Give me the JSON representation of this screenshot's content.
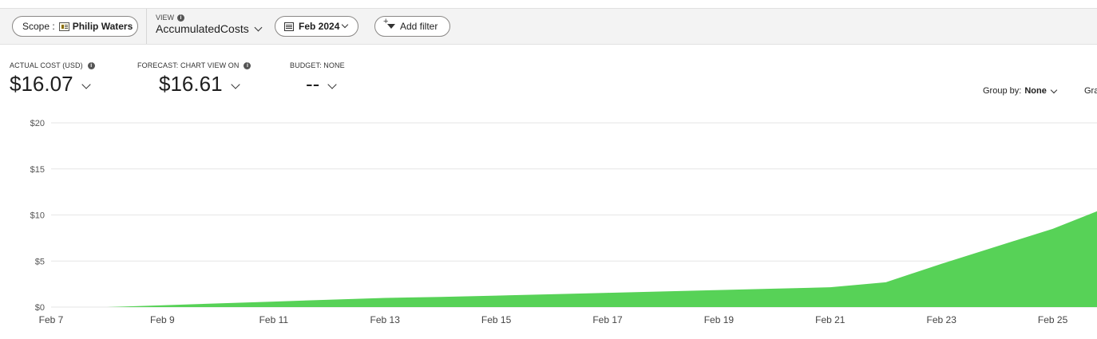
{
  "toolbar": {
    "scope_label": "Scope :",
    "scope_value": "Philip Waters",
    "view_label": "VIEW",
    "view_name": "AccumulatedCosts",
    "date_range": "Feb 2024",
    "add_filter": "Add filter"
  },
  "metrics": {
    "actual_label": "ACTUAL COST (USD)",
    "actual_value": "$16.07",
    "forecast_label": "FORECAST: CHART VIEW ON",
    "forecast_value": "$16.61",
    "budget_label": "BUDGET: NONE",
    "budget_value": "--"
  },
  "controls": {
    "group_by_label": "Group by:",
    "group_by_value": "None",
    "granularity_partial": "Gra"
  },
  "colors": {
    "accent": "#57d257",
    "toolbar": "#f3f3f3"
  },
  "chart_data": {
    "type": "area",
    "x": [
      "Feb 7",
      "Feb 8",
      "Feb 9",
      "Feb 10",
      "Feb 11",
      "Feb 12",
      "Feb 13",
      "Feb 14",
      "Feb 15",
      "Feb 16",
      "Feb 17",
      "Feb 18",
      "Feb 19",
      "Feb 20",
      "Feb 21",
      "Feb 22",
      "Feb 23",
      "Feb 24",
      "Feb 25",
      "Feb 26"
    ],
    "x_tick_labels": [
      "Feb 7",
      "Feb 9",
      "Feb 11",
      "Feb 13",
      "Feb 15",
      "Feb 17",
      "Feb 19",
      "Feb 21",
      "Feb 23",
      "Feb 25"
    ],
    "series": [
      {
        "values": [
          0,
          0,
          0.2,
          0.4,
          0.6,
          0.8,
          1.0,
          1.1,
          1.25,
          1.4,
          1.55,
          1.7,
          1.85,
          2.0,
          2.15,
          2.7,
          4.7,
          6.6,
          8.5,
          10.4
        ]
      }
    ],
    "ylim": [
      0,
      20
    ],
    "y_ticks": [
      0,
      5,
      10,
      15,
      20
    ],
    "y_tick_labels": [
      "$0",
      "$5",
      "$10",
      "$15",
      "$20"
    ],
    "grid": true
  }
}
